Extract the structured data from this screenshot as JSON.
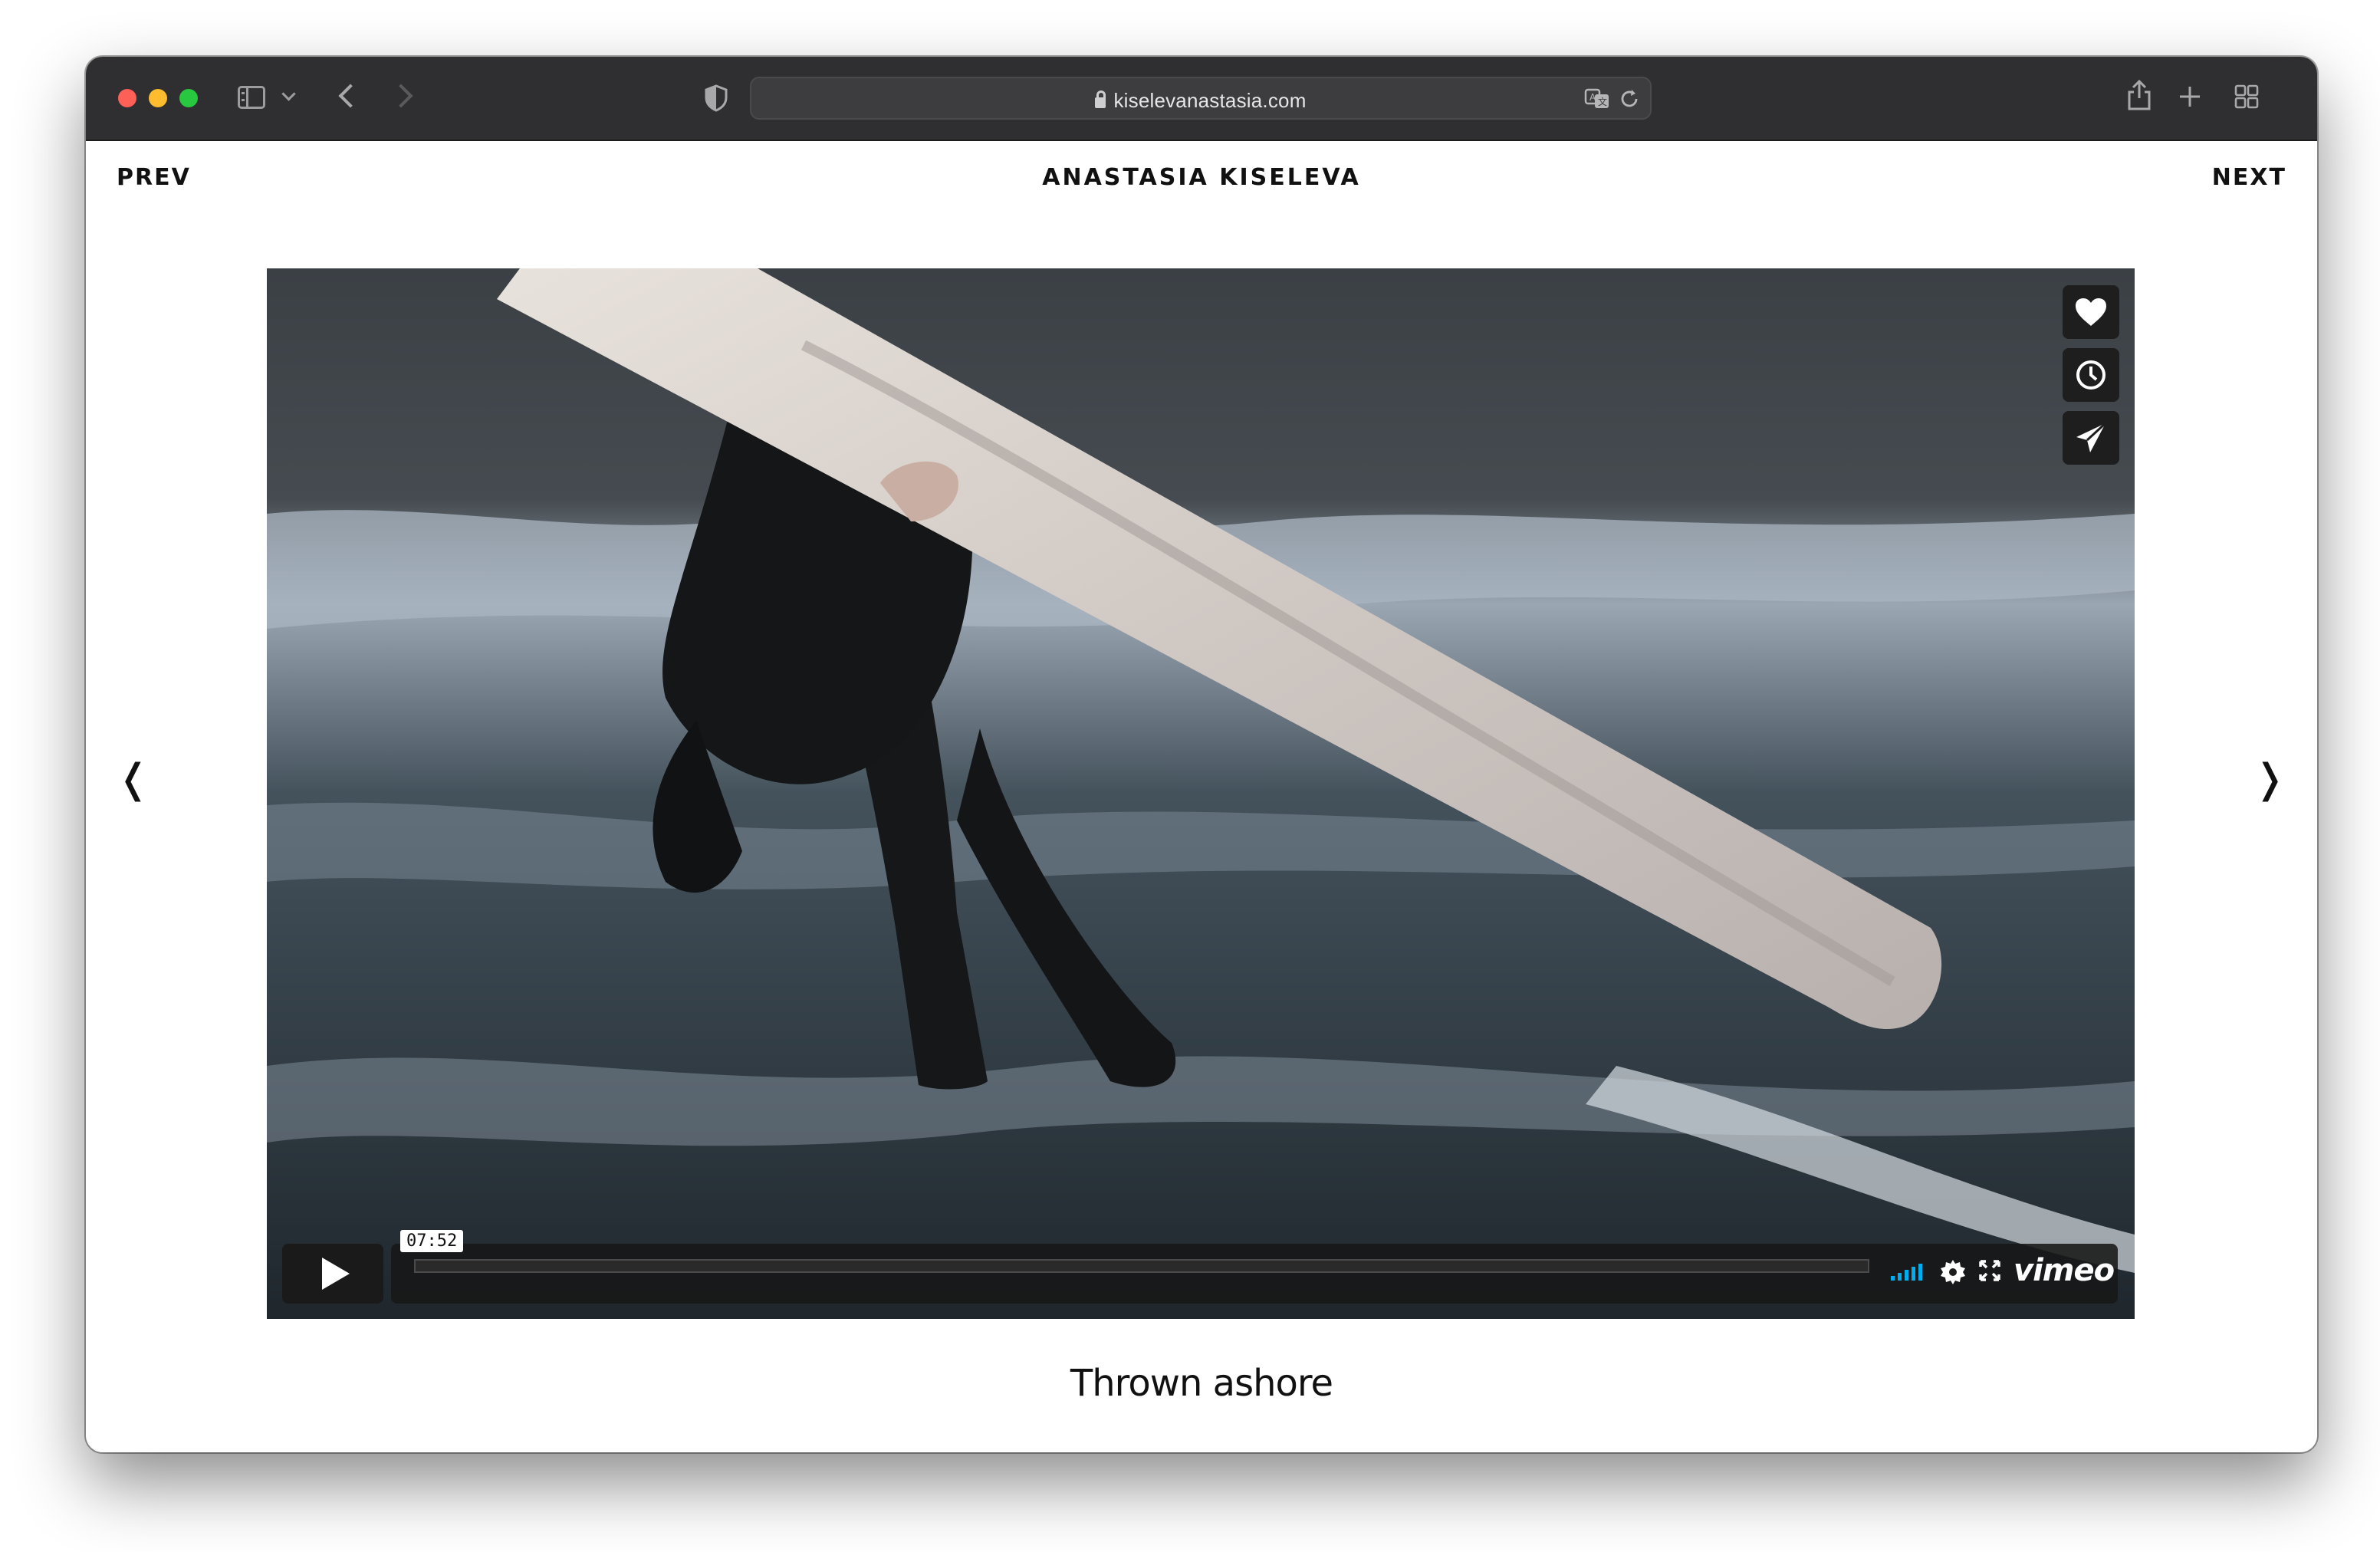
{
  "browser": {
    "url": "kiselevanastasia.com",
    "icons": [
      "sidebar-icon",
      "chevron-down-icon",
      "back-arrow-icon",
      "forward-arrow-icon",
      "shield-icon",
      "lock-icon",
      "translate-icon",
      "reload-icon",
      "share-icon",
      "plus-icon",
      "tabs-icon"
    ]
  },
  "header": {
    "prev_label": "PREV",
    "title": "ANASTASIA KISELEVA",
    "next_label": "NEXT"
  },
  "gallery": {
    "left_arrow": "❬",
    "right_arrow": "❭"
  },
  "player": {
    "timecode": "07:52",
    "progress": 0.0,
    "brand": "vimeo",
    "accent_color": "#00adef",
    "side_buttons": [
      "heart-icon",
      "clock-icon",
      "paper-plane-icon"
    ]
  },
  "caption": "Thrown ashore"
}
